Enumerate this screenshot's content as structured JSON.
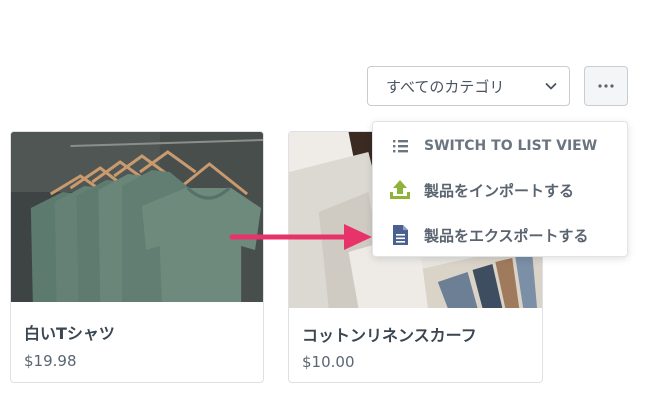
{
  "toolbar": {
    "category_select_value": "すべてのカテゴリ",
    "more_button_glyph": "•••"
  },
  "menu": {
    "items": [
      {
        "label": "SWITCH TO LIST VIEW",
        "icon": "list-icon"
      },
      {
        "label": "製品をインポートする",
        "icon": "upload-icon"
      },
      {
        "label": "製品をエクスポートする",
        "icon": "document-icon"
      }
    ]
  },
  "products": [
    {
      "name": "白いTシャツ",
      "price": "$19.98"
    },
    {
      "name": "コットンリネンスカーフ",
      "price": "$10.00"
    }
  ],
  "colors": {
    "arrow": "#e8336a",
    "upload_icon": "#8fb33a",
    "export_icon": "#4a6190"
  }
}
